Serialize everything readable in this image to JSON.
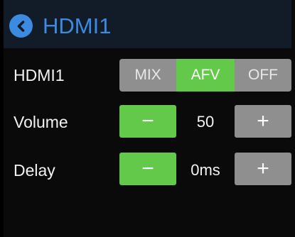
{
  "header": {
    "title": "HDMI1",
    "back_icon": "chevron-left-icon",
    "accent_color": "#3c8be0"
  },
  "mode_row": {
    "label": "HDMI1",
    "options": [
      "MIX",
      "AFV",
      "OFF"
    ],
    "selected": "AFV"
  },
  "volume_row": {
    "label": "Volume",
    "minus_label": "−",
    "value": "50",
    "plus_label": "+"
  },
  "delay_row": {
    "label": "Delay",
    "minus_label": "−",
    "value": "0ms",
    "plus_label": "+"
  },
  "colors": {
    "active_green": "#63c94b",
    "inactive_gray": "#8f8f8f"
  }
}
